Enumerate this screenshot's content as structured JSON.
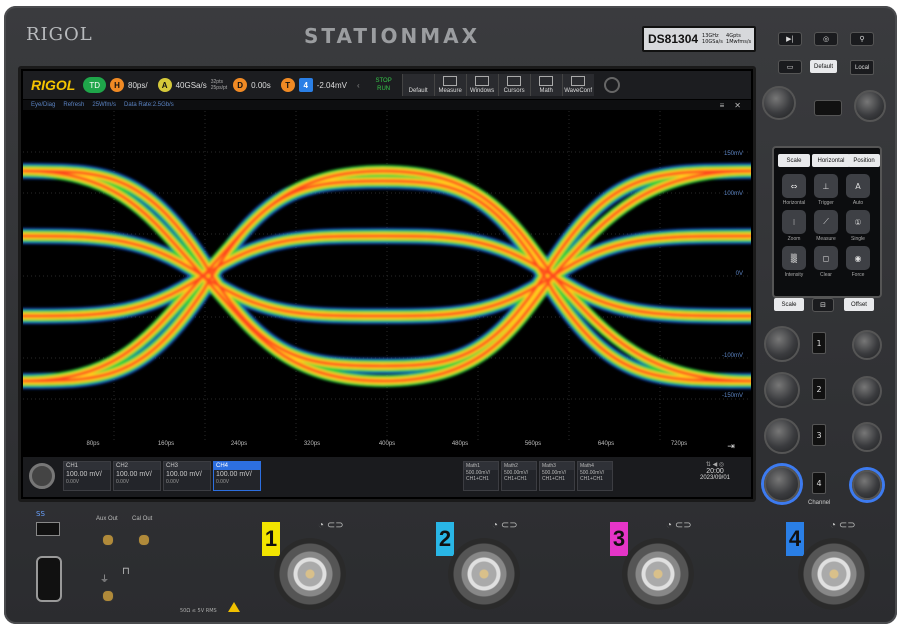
{
  "device": {
    "brand": "RIGOL",
    "series": "STATIONMAX",
    "model": "DS81304",
    "model_spec_1": "13GHz 10GSa/s",
    "model_spec_2": "4Gpts 1Mwfms/s"
  },
  "toolbar": {
    "logo": "RIGOL",
    "trigger_mode": "TD",
    "h_label": "H",
    "timebase": "80ps/",
    "a_label": "A",
    "sample_rate": "40GSa/s",
    "mem_depth_1": "32pts",
    "mem_depth_2": "25ps/pt",
    "d_label": "D",
    "delay": "0.00s",
    "t_label": "T",
    "trig_channel": "4",
    "trig_level": "-2.04mV",
    "stop_label": "STOP",
    "run_label": "RUN",
    "default_label": "Default",
    "buttons": [
      "Measure",
      "Windows",
      "Cursors",
      "Math",
      "WaveConf"
    ]
  },
  "infobar": {
    "items": [
      "Eye/Diag",
      "Refresh",
      "25Wfm/s",
      "Data Rate:2.5Gb/s"
    ],
    "menu": "≡",
    "close": "✕"
  },
  "plot": {
    "x_ticks": [
      "80ps",
      "160ps",
      "240ps",
      "320ps",
      "400ps",
      "480ps",
      "560ps",
      "640ps",
      "720ps"
    ],
    "y_labels": [
      "150mV",
      "100mV",
      "0V",
      "-100mV",
      "-150mV"
    ]
  },
  "channels": [
    {
      "name": "CH1",
      "scale": "100.00 mV/",
      "offset": "0.00V"
    },
    {
      "name": "CH2",
      "scale": "100.00 mV/",
      "offset": "0.00V"
    },
    {
      "name": "CH3",
      "scale": "100.00 mV/",
      "offset": "0.00V"
    },
    {
      "name": "CH4",
      "scale": "100.00 mV/",
      "offset": "0.00V"
    }
  ],
  "maths": [
    {
      "name": "Math1",
      "scale": "500.00mV/",
      "src": "CH1+CH1"
    },
    {
      "name": "Math2",
      "scale": "500.00mV/",
      "src": "CH1+CH1"
    },
    {
      "name": "Math3",
      "scale": "500.00mV/",
      "src": "CH1+CH1"
    },
    {
      "name": "Math4",
      "scale": "500.00mV/",
      "src": "CH1+CH1"
    }
  ],
  "clock": {
    "time": "20:00",
    "date": "2023/09/01"
  },
  "panel": {
    "default": "Default",
    "local": "Local",
    "scale": "Scale",
    "horizontal": "Horizontal",
    "position": "Position",
    "touch_labels": [
      "Horizontal",
      "Trigger",
      "Auto",
      "Zoom",
      "Measure",
      "Single",
      "Intensity",
      "Clear",
      "Force"
    ],
    "scale2": "Scale",
    "offset": "Offset",
    "channel_numbers": [
      "1",
      "2",
      "3",
      "4"
    ],
    "channel": "Channel"
  },
  "front": {
    "usb": "SS",
    "aux_out": "Aux Out",
    "cal_out": "Cal Out",
    "inputs": [
      "1",
      "2",
      "3",
      "4"
    ],
    "input_colors": [
      "#f2e400",
      "#29b6e6",
      "#e535c8",
      "#2a7fe6"
    ],
    "spec": "50Ω ≤ 5V RMS"
  }
}
